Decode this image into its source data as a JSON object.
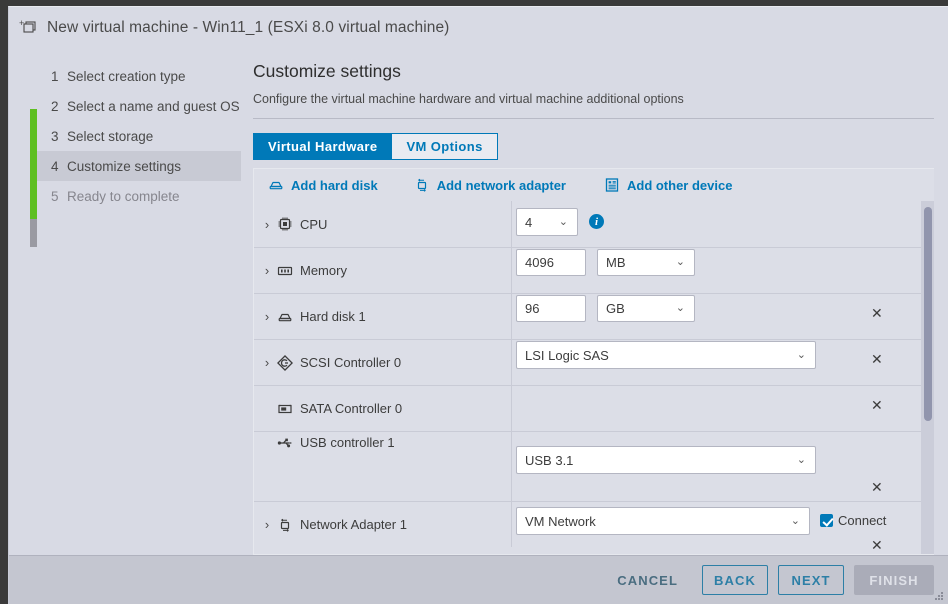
{
  "window": {
    "title": "New virtual machine - Win11_1 (ESXi 8.0 virtual machine)",
    "title_icon": "new-vm-icon"
  },
  "sidebar": {
    "steps": [
      {
        "num": "1",
        "label": "Select creation type",
        "state": "done"
      },
      {
        "num": "2",
        "label": "Select a name and guest OS",
        "state": "done"
      },
      {
        "num": "3",
        "label": "Select storage",
        "state": "done"
      },
      {
        "num": "4",
        "label": "Customize settings",
        "state": "active"
      },
      {
        "num": "5",
        "label": "Ready to complete",
        "state": "pending"
      }
    ],
    "progress_color": "#5ebf21",
    "progress_remaining_color": "#9a9aa2"
  },
  "header": {
    "title": "Customize settings",
    "subtitle": "Configure the virtual machine hardware and virtual machine additional options"
  },
  "tabs": [
    {
      "label": "Virtual Hardware",
      "active": true
    },
    {
      "label": "VM Options",
      "active": false
    }
  ],
  "toolbar": {
    "actions": [
      {
        "label": "Add hard disk",
        "icon": "hard-disk-icon"
      },
      {
        "label": "Add network adapter",
        "icon": "network-adapter-icon"
      },
      {
        "label": "Add other device",
        "icon": "other-device-icon"
      }
    ],
    "link_color": "#0079b8"
  },
  "devices": [
    {
      "name": "CPU",
      "icon": "cpu-icon",
      "expandable": true,
      "value": "4",
      "control": "select",
      "info": true,
      "removable": false
    },
    {
      "name": "Memory",
      "icon": "memory-icon",
      "expandable": true,
      "value": "4096",
      "control": "text-with-unit",
      "unit": "MB",
      "removable": false
    },
    {
      "name": "Hard disk 1",
      "icon": "hard-disk-icon",
      "expandable": true,
      "value": "96",
      "control": "text-with-unit",
      "unit": "GB",
      "removable": true
    },
    {
      "name": "SCSI Controller 0",
      "icon": "scsi-controller-icon",
      "expandable": true,
      "value": "LSI Logic SAS",
      "control": "wide-select",
      "removable": true
    },
    {
      "name": "SATA Controller 0",
      "icon": "sata-controller-icon",
      "expandable": false,
      "value": "",
      "control": "none",
      "removable": true
    },
    {
      "name": "USB controller 1",
      "icon": "usb-controller-icon",
      "expandable": false,
      "value": "USB 3.1",
      "control": "wide-select",
      "removable": true
    },
    {
      "name": "Network Adapter 1",
      "icon": "network-adapter-icon",
      "expandable": true,
      "value": "VM Network",
      "control": "wide-select",
      "checkbox_label": "Connect",
      "checkbox_checked": true,
      "removable": true
    }
  ],
  "remove_glyph": "✕",
  "chevron_glyph": "›",
  "caret_glyph": "⌄",
  "info_glyph": "i",
  "footer": {
    "cancel": "CANCEL",
    "back": "BACK",
    "next": "NEXT",
    "finish": "FINISH"
  },
  "colors": {
    "accent": "#0079b8",
    "tab_active_bg": "#0079b8",
    "window_bg": "#d8dae4",
    "footer_bg": "#c4c6d0",
    "table_bg": "#dcdee7"
  }
}
